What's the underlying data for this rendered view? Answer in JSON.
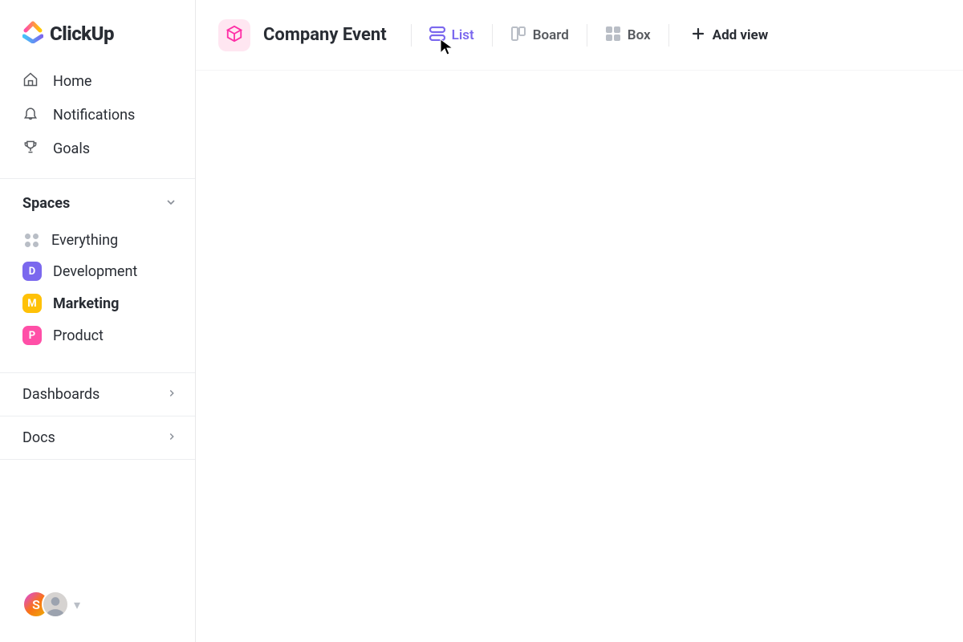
{
  "brand": {
    "name": "ClickUp"
  },
  "nav": {
    "home": "Home",
    "notifications": "Notifications",
    "goals": "Goals"
  },
  "spaces": {
    "heading": "Spaces",
    "everything": "Everything",
    "items": [
      {
        "initial": "D",
        "label": "Development",
        "color": "purple",
        "active": false
      },
      {
        "initial": "M",
        "label": "Marketing",
        "color": "yellow",
        "active": true
      },
      {
        "initial": "P",
        "label": "Product",
        "color": "pink",
        "active": false
      }
    ]
  },
  "sections": {
    "dashboards": "Dashboards",
    "docs": "Docs"
  },
  "avatars": {
    "primary_initial": "S"
  },
  "header": {
    "project_title": "Company Event",
    "views": {
      "list": "List",
      "board": "Board",
      "box": "Box"
    },
    "add_view": "Add view"
  }
}
